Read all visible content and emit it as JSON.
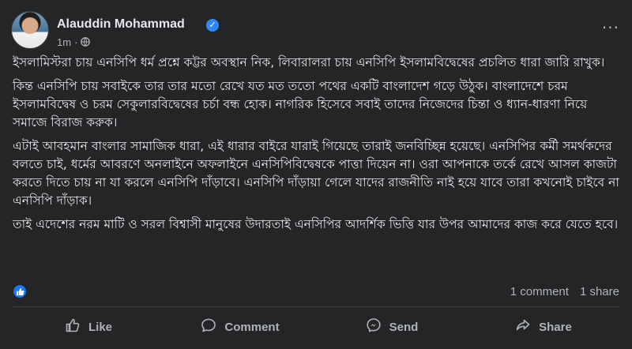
{
  "post": {
    "author": {
      "name": "Alauddin Mohammad",
      "verified_icon": "verified-badge-icon"
    },
    "meta": {
      "time": "1m",
      "separator": "·",
      "audience_icon": "globe-icon"
    },
    "more_icon": "more-options-icon",
    "paragraphs": [
      "ইসলামিস্টরা চায় এনসিপি ধর্ম প্রশ্নে কট্টর অবস্থান নিক, লিবারালরা চায় এনসিপি ইসলামবিদ্বেষের প্রচলিত ধারা জারি রাখুক।",
      "কিন্ত এনসিপি চায় সবাইকে তার তার মতো রেখে যত মত ততো পথের একটি বাংলাদেশ গড়ে উঠুক। বাংলাদেশে চরম ইসলামবিদ্বেষ ও চরম সেকুলারবিদ্বেষের চর্চা বন্ধ হোক। নাগরিক হিসেবে সবাই তাদের নিজেদের চিন্তা ও ধ্যান-ধারণা নিয়ে সমাজে বিরাজ করুক।",
      "এটাই আবহমান বাংলার সামাজিক ধারা, এই ধারার বাইরে যারাই গিয়েছে তারাই জনবিচ্ছিন্ন হয়েছে। এনসিপির কর্মী সমর্থকদের বলতে চাই, ধর্মের আবরণে অনলাইনে অফলাইনে এনসিপিবিদ্বেষকে পাত্তা দিয়েন না। ওরা আপনাকে তর্কে রেখে আসল কাজটা করতে দিতে চায় না যা করলে এনসিপি দাঁড়াবে। এনসিপি দাঁড়ায়া গেলে যাদের রাজনীতি নাই হয়ে যাবে তারা কখনোই চাইবে না এনসিপি দাঁড়াক।",
      "তাই এদেশের নরম মাটি ও সরল বিশ্বাসী মানুষের উদারতাই এনসিপির আদর্শিক ভিত্তি যার উপর আমাদের কাজ করে যেতে হবে।"
    ],
    "reactions": {
      "icon": "like-reaction-icon"
    },
    "counts": {
      "comments": "1 comment",
      "shares": "1 share"
    },
    "actions": [
      {
        "label": "Like",
        "icon": "thumbs-up-icon"
      },
      {
        "label": "Comment",
        "icon": "comment-bubble-icon"
      },
      {
        "label": "Send",
        "icon": "messenger-icon"
      },
      {
        "label": "Share",
        "icon": "share-arrow-icon"
      }
    ]
  },
  "colors": {
    "background": "#242526",
    "text": "#e4e6eb",
    "secondary": "#b0b3b8",
    "accent": "#1877f2"
  }
}
